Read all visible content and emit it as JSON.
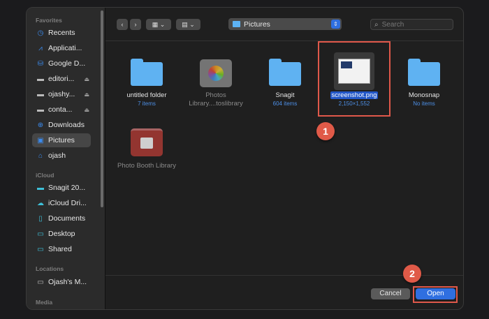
{
  "sidebar": {
    "sections": [
      "Favorites",
      "iCloud",
      "Locations",
      "Media"
    ],
    "favorites": [
      {
        "label": "Recents",
        "icon": "clock-icon"
      },
      {
        "label": "Applicati...",
        "icon": "apps-icon"
      },
      {
        "label": "Google D...",
        "icon": "drive-icon"
      },
      {
        "label": "editori...",
        "icon": "folder-icon",
        "eject": true
      },
      {
        "label": "ojashy...",
        "icon": "folder-icon",
        "eject": true
      },
      {
        "label": "conta...",
        "icon": "folder-icon",
        "eject": true
      },
      {
        "label": "Downloads",
        "icon": "download-icon"
      },
      {
        "label": "Pictures",
        "icon": "pictures-icon",
        "selected": true
      },
      {
        "label": "ojash",
        "icon": "home-icon"
      }
    ],
    "icloud": [
      {
        "label": "Snagit 20...",
        "icon": "folder-icon"
      },
      {
        "label": "iCloud Dri...",
        "icon": "cloud-icon"
      },
      {
        "label": "Documents",
        "icon": "document-icon"
      },
      {
        "label": "Desktop",
        "icon": "desktop-icon"
      },
      {
        "label": "Shared",
        "icon": "shared-folder-icon"
      }
    ],
    "locations": [
      {
        "label": "Ojash's M...",
        "icon": "laptop-icon"
      }
    ]
  },
  "toolbar": {
    "location": "Pictures",
    "search_placeholder": "Search"
  },
  "files": [
    {
      "name": "untitled folder",
      "sub": "7 items",
      "type": "folder"
    },
    {
      "name": "Photos Library....toslibrary",
      "sub": "",
      "type": "photos"
    },
    {
      "name": "Snagit",
      "sub": "604 items",
      "type": "folder"
    },
    {
      "name": "screenshot.png",
      "sub": "2,150×1,552",
      "type": "image",
      "selected": true
    },
    {
      "name": "Monosnap",
      "sub": "No items",
      "type": "folder"
    },
    {
      "name": "Photo Booth Library",
      "sub": "",
      "type": "photobooth"
    }
  ],
  "annotations": [
    "1",
    "2"
  ],
  "buttons": {
    "cancel": "Cancel",
    "open": "Open"
  },
  "colors": {
    "accent": "#2f6fe0",
    "highlight": "#e0584a",
    "folder": "#5fb2f2"
  }
}
